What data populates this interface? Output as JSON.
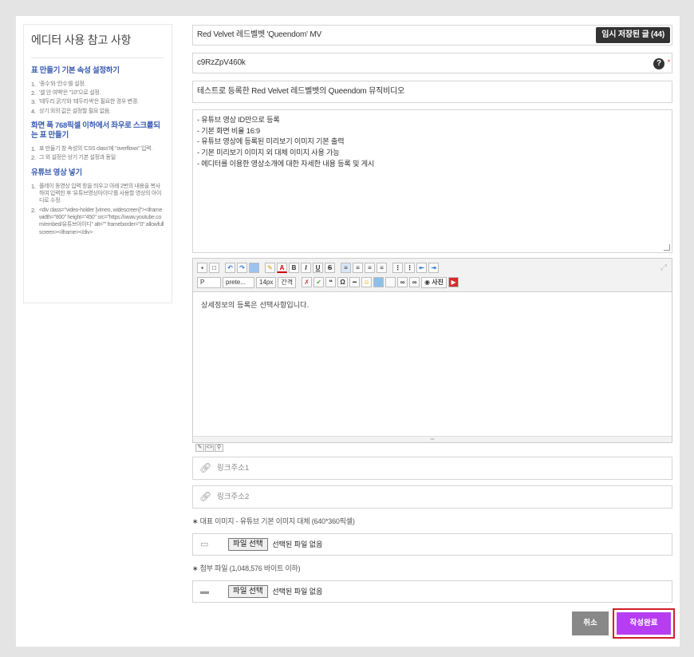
{
  "help": {
    "title": "에디터 사용 참고 사항",
    "sections": [
      {
        "heading": "표 만들기 기본 속성 설정하기",
        "items": [
          "'종수'와 '칸수'를 설정.",
          "'셀 안 여백'은 \"10\"으로 설정.",
          "'테두리 굵기'와 '테두리색'은 필요한 경우 변경.",
          "상기 외의 값은 설정할 필요 없음."
        ]
      },
      {
        "heading": "화면 폭 768픽셀 이하에서 좌우로 스크롤되는 표 만들기",
        "items": [
          "표 만들기 창 속성의 'CSS class'에 \"overflowx\" 입력.",
          "그 외 설정은 상기 기본 설정과 동일"
        ]
      },
      {
        "heading": "유튜브 영상 넣기",
        "items": [
          "플레이 동영상 입력 창을 띄우고 아래 2번의 내용을 복사하여 입력한 후 '유튜브영상아이디'를 사용할 영상의 아이디로 수정.",
          "<div class=\"video-holder [vimeo, widescreen]\"><iframe width=\"800\" height=\"450\" src=\"https://www.youtube.com/embed/유튜브아이디\" alt=\"\" frameborder=\"0\" allowfullscreen></iframe></div>"
        ]
      }
    ]
  },
  "form": {
    "title_value": "Red Velvet 레드벨벳 'Queendom' MV",
    "temp_button": "임시 저장된 글 (44)",
    "video_id": "c9RzZpV460k",
    "help_mark": "?",
    "required_mark": "*",
    "summary": "테스트로 등록한 Red Velvet 레드벨벳의 Queendom 뮤직비디오",
    "description_lines": [
      "- 유튜브 영상 ID만으로 등록",
      "- 기본 화면 비율 16:9",
      "- 유튜브 영상에 등록된 미리보기 이미지 기본 출력",
      "- 기본 미리보기 이미지 외 대체 이미지 사용 가능",
      "- 에디터를 이용한 영상소개에 대한 자세한 내용 등록 및 게시"
    ],
    "editor": {
      "format_select": "P",
      "font_select": "prete...",
      "size_select": "14px",
      "line_select": "간격",
      "photo_button": "사진",
      "content": "상세정보의 등록은 선택사항입니다."
    },
    "link1_placeholder": "링크주소1",
    "link2_placeholder": "링크주소2",
    "image_note": "대표 이미지 - 유튜브 기본 이미지 대체 (640*360픽셀)",
    "attach_note": "첨부 파일 (1,048,576 바이트 이하)",
    "file_button": "파일 선택",
    "file_none": "선택된 파일 없음",
    "cancel": "취소",
    "submit": "작성완료"
  }
}
